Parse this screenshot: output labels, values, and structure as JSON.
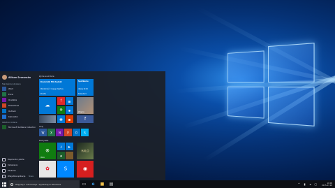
{
  "start_menu": {
    "user_name": "Allison Svoronska",
    "most_used_label": "Najczęściej używane",
    "apps": [
      {
        "label": "Word",
        "icon": "word-icon",
        "color": "#2b579a"
      },
      {
        "label": "Excel",
        "icon": "excel-icon",
        "color": "#217346"
      },
      {
        "label": "OneNote",
        "icon": "onenote-icon",
        "color": "#7719aa"
      },
      {
        "label": "PowerPoint",
        "icon": "powerpoint-icon",
        "color": "#d24726"
      },
      {
        "label": "Outlook",
        "icon": "outlook-icon",
        "color": "#0072c6"
      },
      {
        "label": "Kalkulator",
        "icon": "calculator-icon",
        "color": "#1e6fd0"
      }
    ],
    "recent_label": "Ostatnio dodane",
    "recent_app": "Microsoft Solitaire Collection",
    "bottom": [
      {
        "label": "Eksplorator plików",
        "icon": "folder-icon"
      },
      {
        "label": "Ustawienia",
        "icon": "gear-icon"
      },
      {
        "label": "Zasilanie",
        "icon": "power-icon"
      },
      {
        "label": "Wszystkie aplikacje",
        "icon": "apps-icon",
        "extra": "Nowe"
      }
    ],
    "groups": {
      "life": "Życie w skrócie",
      "play": "Graj",
      "explore": "Rozrywka"
    },
    "tiles": {
      "mail_sender": "Dominik Michalski",
      "mail_subject": "Wiadomość z mojego telefonu",
      "mail_app": "Poczta",
      "calendar_title": "Spotkanie",
      "calendar_detail": "dzisiaj 10:00",
      "calendar_app": "Kalendarz",
      "edge_label": "Microsoft Edge",
      "photos_label": "Zdjęcia",
      "store_label": "Sklep",
      "xbox_label": "Xbox"
    }
  },
  "taskbar": {
    "search_placeholder": "Zapytaj o informacje i wyszukaj w Windows",
    "time": "10:00",
    "date": "2015-07-29"
  }
}
